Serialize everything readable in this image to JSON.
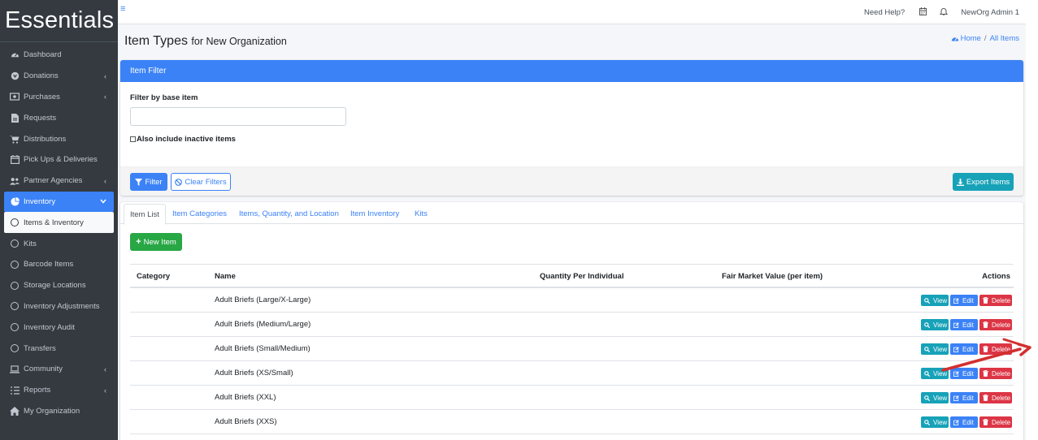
{
  "sidebar": {
    "brand": "Essentials",
    "items": [
      {
        "label": "Dashboard",
        "icon": "dashboard-icon",
        "chevron": false
      },
      {
        "label": "Donations",
        "icon": "donations-icon",
        "chevron": true
      },
      {
        "label": "Purchases",
        "icon": "purchases-icon",
        "chevron": true
      },
      {
        "label": "Requests",
        "icon": "requests-icon",
        "chevron": false
      },
      {
        "label": "Distributions",
        "icon": "cart-icon",
        "chevron": false
      },
      {
        "label": "Pick Ups & Deliveries",
        "icon": "calendar-icon",
        "chevron": false
      },
      {
        "label": "Partner Agencies",
        "icon": "users-icon",
        "chevron": true
      },
      {
        "label": "Inventory",
        "icon": "pie-icon",
        "chevron": true
      },
      {
        "label": "Items & Inventory",
        "icon": "circle-icon",
        "chevron": false
      },
      {
        "label": "Kits",
        "icon": "circle-icon",
        "chevron": false
      },
      {
        "label": "Barcode Items",
        "icon": "circle-icon",
        "chevron": false
      },
      {
        "label": "Storage Locations",
        "icon": "circle-icon",
        "chevron": false
      },
      {
        "label": "Inventory Adjustments",
        "icon": "circle-icon",
        "chevron": false
      },
      {
        "label": "Inventory Audit",
        "icon": "circle-icon",
        "chevron": false
      },
      {
        "label": "Transfers",
        "icon": "circle-icon",
        "chevron": false
      },
      {
        "label": "Community",
        "icon": "laptop-icon",
        "chevron": true
      },
      {
        "label": "Reports",
        "icon": "list-icon",
        "chevron": true
      },
      {
        "label": "My Organization",
        "icon": "home-icon",
        "chevron": false
      }
    ]
  },
  "topbar": {
    "help": "Need Help?",
    "user": "NewOrg Admin 1"
  },
  "page": {
    "title": "Item Types",
    "subtitle": "for New Organization",
    "breadcrumb_home": "Home",
    "breadcrumb_sep": "/",
    "breadcrumb_current": "All Items"
  },
  "filter": {
    "header": "Item Filter",
    "label": "Filter by base item",
    "input_value": "",
    "checkbox_label": "Also include inactive items",
    "filter_button": "Filter",
    "clear_button": "Clear Filters",
    "export_button": "Export Items"
  },
  "tabs": [
    "Item List",
    "Item Categories",
    "Items, Quantity, and Location",
    "Item Inventory",
    "Kits"
  ],
  "new_item_button": "New Item",
  "table": {
    "headers": {
      "category": "Category",
      "name": "Name",
      "qty": "Quantity Per Individual",
      "fmv": "Fair Market Value (per item)",
      "actions": "Actions"
    },
    "rows": [
      {
        "name": "Adult Briefs (Large/X-Large)"
      },
      {
        "name": "Adult Briefs (Medium/Large)"
      },
      {
        "name": "Adult Briefs (Small/Medium)"
      },
      {
        "name": "Adult Briefs (XS/Small)"
      },
      {
        "name": "Adult Briefs (XXL)"
      },
      {
        "name": "Adult Briefs (XXS)"
      }
    ],
    "view_label": "View",
    "edit_label": "Edit",
    "delete_label": "Delete"
  },
  "colors": {
    "primary": "#3b82f6",
    "sidebar": "#343a40",
    "info": "#17a2b8",
    "success": "#28a745",
    "danger": "#dc3545",
    "annotation": "#d32f2f"
  }
}
